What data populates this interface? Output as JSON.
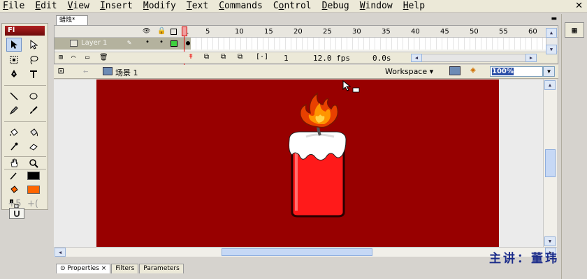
{
  "menu": {
    "items": [
      "File",
      "Edit",
      "View",
      "Insert",
      "Modify",
      "Text",
      "Commands",
      "Control",
      "Debug",
      "Window",
      "Help"
    ],
    "underline": [
      "F",
      "E",
      "V",
      "I",
      "M",
      "T",
      "C",
      "o",
      "D",
      "W",
      "H"
    ],
    "close_glyph": "✕"
  },
  "toolbar": {
    "logo": "Fl",
    "tools": [
      "arrow-icon",
      "subselect-icon",
      "free-transform-icon",
      "lasso-icon",
      "pen-icon",
      "text-icon",
      "line-icon",
      "oval-icon",
      "pencil-icon",
      "brush-icon",
      "ink-bottle-icon",
      "paint-bucket-icon",
      "eyedropper-icon",
      "eraser-icon",
      "hand-icon",
      "zoom-icon",
      "stroke-color-icon",
      "fill-color-icon",
      "snap-magnet-icon"
    ],
    "stroke_color": "#000000",
    "fill_color": "#ff6600"
  },
  "doc_tab": {
    "label": "蜡烛*"
  },
  "timeline": {
    "ruler": [
      "1",
      "5",
      "10",
      "15",
      "20",
      "25",
      "30",
      "35",
      "40",
      "45",
      "50",
      "55",
      "60"
    ],
    "layer_name": "Layer 1",
    "current_frame": "1",
    "fps": "12.0 fps",
    "elapsed": "0.0s"
  },
  "editbar": {
    "scene": "场景 1",
    "workspace": "Workspace",
    "zoom": "100%"
  },
  "stage": {
    "background": "#980000",
    "candle_body": "#ff1a1a",
    "wax_top": "#ffffff",
    "flame_outer": "#e84000",
    "flame_inner": "#ffb400"
  },
  "panels": {
    "tabs": [
      "Properties",
      "Filters",
      "Parameters"
    ],
    "properties_close": "×"
  },
  "credit": "主讲：董玮"
}
